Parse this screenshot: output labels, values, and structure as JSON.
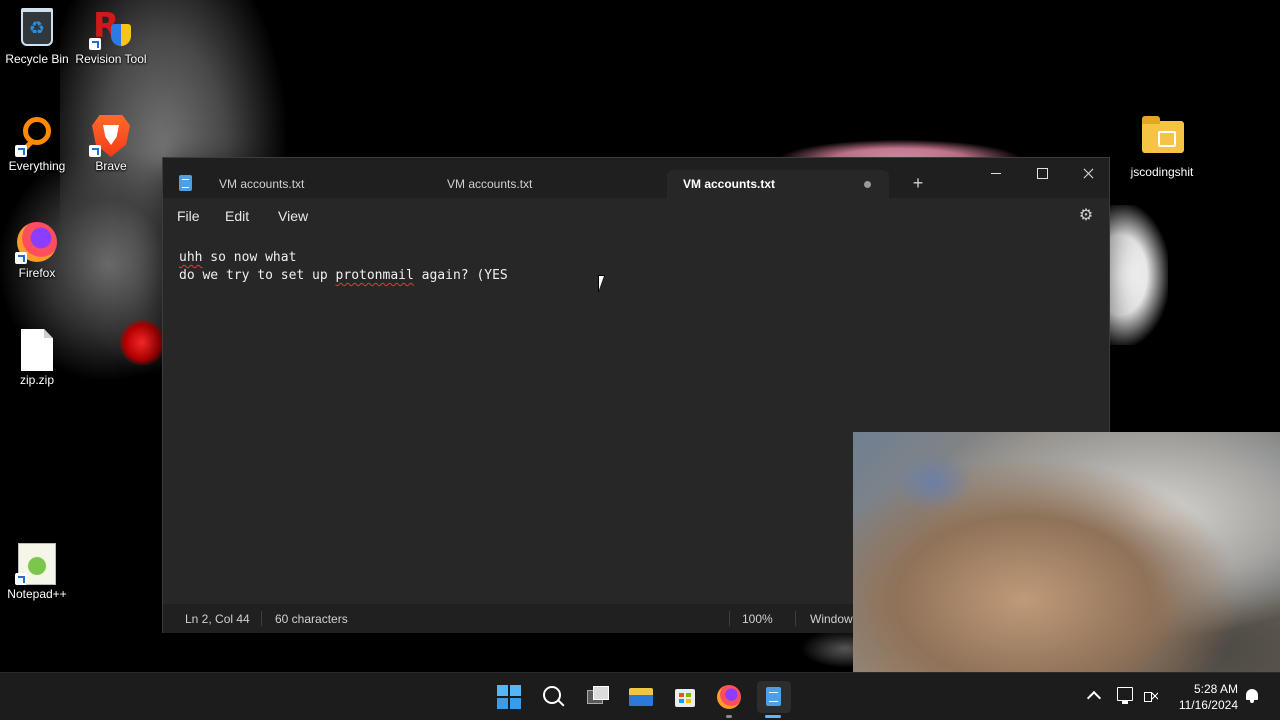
{
  "desktop": {
    "icons": [
      {
        "label": "Recycle Bin",
        "icon": "recycle-bin-icon"
      },
      {
        "label": "Revision Tool",
        "icon": "revision-tool-icon"
      },
      {
        "label": "Everything",
        "icon": "everything-search-icon"
      },
      {
        "label": "Brave",
        "icon": "brave-browser-icon"
      },
      {
        "label": "Firefox",
        "icon": "firefox-icon"
      },
      {
        "label": "zip.zip",
        "icon": "file-icon"
      },
      {
        "label": "Notepad++",
        "icon": "notepad-plus-plus-icon"
      },
      {
        "label": "jscodingshit",
        "icon": "folder-icon"
      }
    ]
  },
  "notepad": {
    "tabs": [
      {
        "label": "VM accounts.txt",
        "active": false
      },
      {
        "label": "VM accounts.txt",
        "active": false
      },
      {
        "label": "VM accounts.txt",
        "active": true,
        "unsaved": true
      }
    ],
    "new_tab_label": "+",
    "menu": {
      "file": "File",
      "edit": "Edit",
      "view": "View"
    },
    "settings_icon": "gear-icon",
    "content": {
      "line1_a": "uhh",
      "line1_b": " so now what",
      "line2_a": "do we try to set up ",
      "line2_b": "protonmail",
      "line2_c": " again? (YES"
    },
    "status": {
      "position": "Ln 2, Col 44",
      "characters": "60 characters",
      "zoom": "100%",
      "eol": "Window"
    }
  },
  "taskbar": {
    "apps": [
      "windows-start-icon",
      "search-icon",
      "task-view-icon",
      "file-explorer-icon",
      "microsoft-store-icon",
      "firefox-icon",
      "notepad-icon"
    ],
    "clock": {
      "time": "5:28 AM",
      "date": "11/16/2024"
    }
  },
  "colors": {
    "taskbar_bg": "#1c1c1c",
    "notepad_bg": "#272727",
    "accent": "#63b4ff"
  }
}
